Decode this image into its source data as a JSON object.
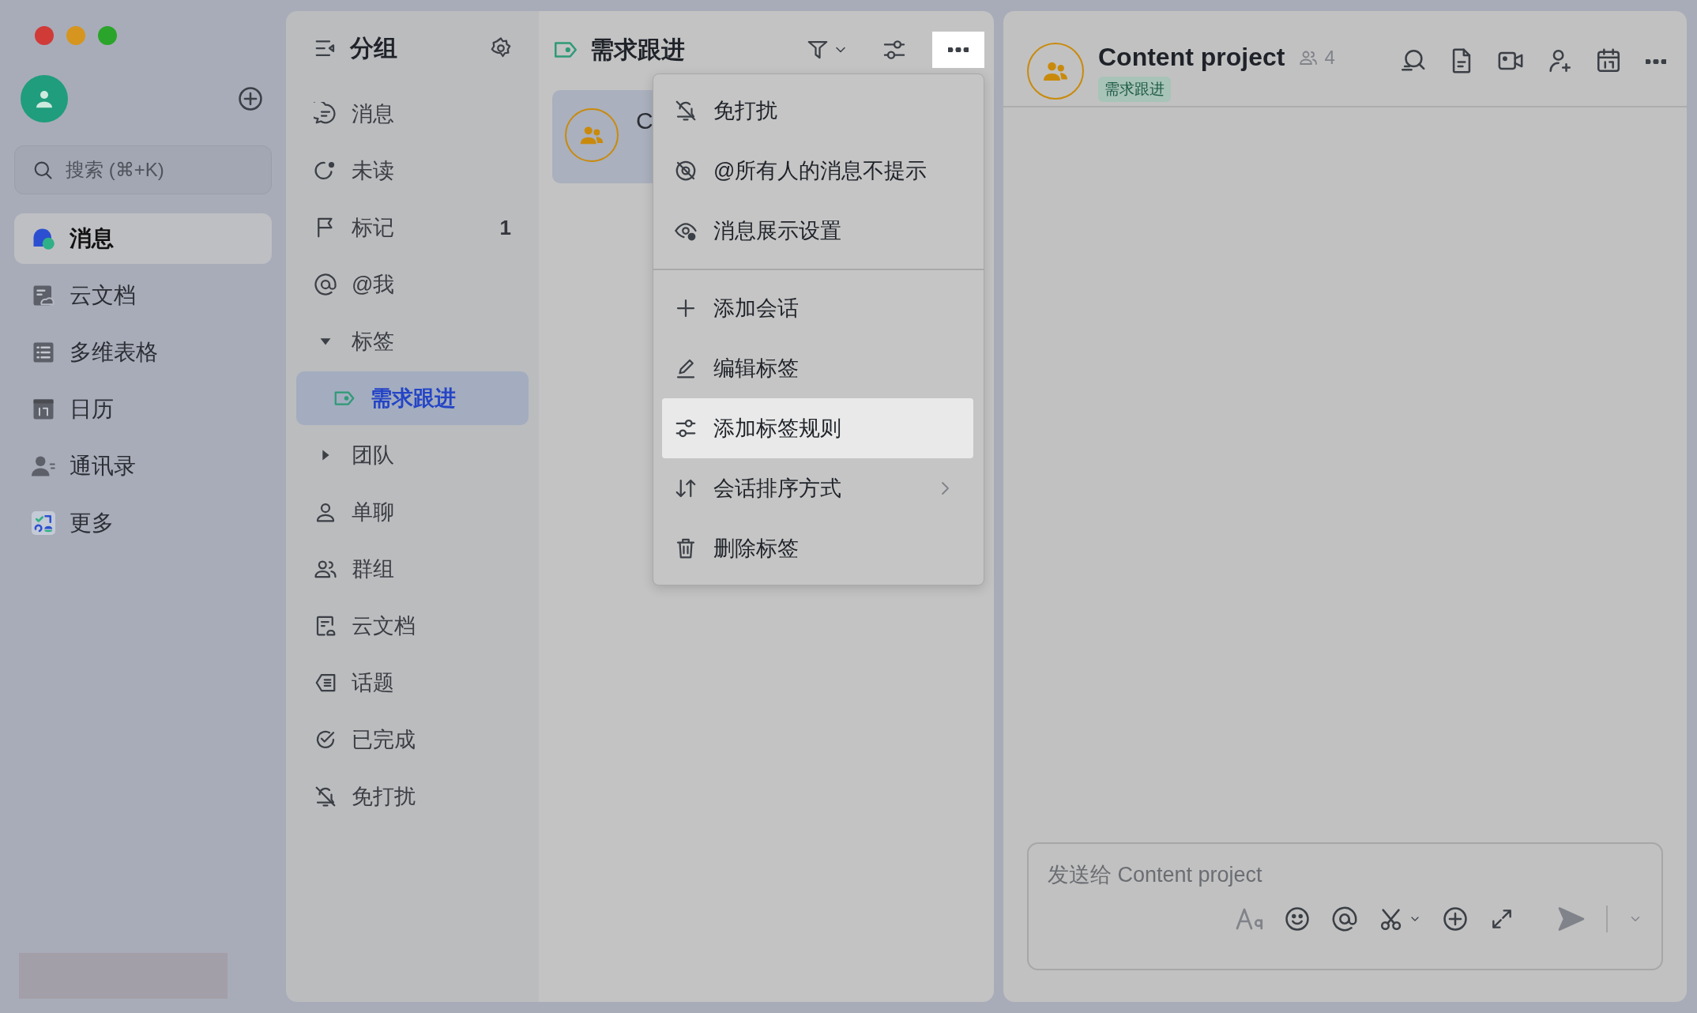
{
  "sidebar": {
    "search": {
      "placeholder": "搜索 (⌘+K)"
    },
    "items": [
      {
        "label": "消息",
        "selected": true
      },
      {
        "label": "云文档",
        "selected": false
      },
      {
        "label": "多维表格",
        "selected": false
      },
      {
        "label": "日历",
        "selected": false
      },
      {
        "label": "通讯录",
        "selected": false
      },
      {
        "label": "更多",
        "selected": false
      }
    ]
  },
  "groups": {
    "title": "分组",
    "items": [
      {
        "label": "消息",
        "selected": false
      },
      {
        "label": "未读",
        "selected": false
      },
      {
        "label": "标记",
        "count": "1",
        "selected": false
      },
      {
        "label": "@我",
        "selected": false
      },
      {
        "label": "标签",
        "kind": "folder",
        "expanded": true,
        "selected": false,
        "children": [
          {
            "label": "需求跟进",
            "selected": true
          }
        ]
      },
      {
        "label": "团队",
        "kind": "folder",
        "expanded": false,
        "selected": false
      },
      {
        "label": "单聊",
        "selected": false
      },
      {
        "label": "群组",
        "selected": false
      },
      {
        "label": "云文档",
        "selected": false
      },
      {
        "label": "话题",
        "selected": false
      },
      {
        "label": "已完成",
        "selected": false
      },
      {
        "label": "免打扰",
        "selected": false
      }
    ]
  },
  "chat_list": {
    "title": "需求跟进",
    "menu_open": true,
    "chats": [
      {
        "title": "C",
        "selected": true
      }
    ]
  },
  "menu": {
    "sections": [
      [
        {
          "label": "免打扰",
          "selected": false,
          "submenu": false
        },
        {
          "label": "@所有人的消息不提示",
          "selected": false,
          "submenu": false
        },
        {
          "label": "消息展示设置",
          "selected": false,
          "submenu": false
        }
      ],
      [
        {
          "label": "添加会话",
          "selected": false,
          "submenu": false
        },
        {
          "label": "编辑标签",
          "selected": false,
          "submenu": false
        },
        {
          "label": "添加标签规则",
          "selected": true,
          "submenu": false
        },
        {
          "label": "会话排序方式",
          "selected": false,
          "submenu": true
        },
        {
          "label": "删除标签",
          "selected": false,
          "submenu": false
        }
      ]
    ]
  },
  "chat": {
    "title": "Content project",
    "member_count": "4",
    "tag": "需求跟进",
    "input": {
      "placeholder": "发送给 Content project"
    }
  }
}
